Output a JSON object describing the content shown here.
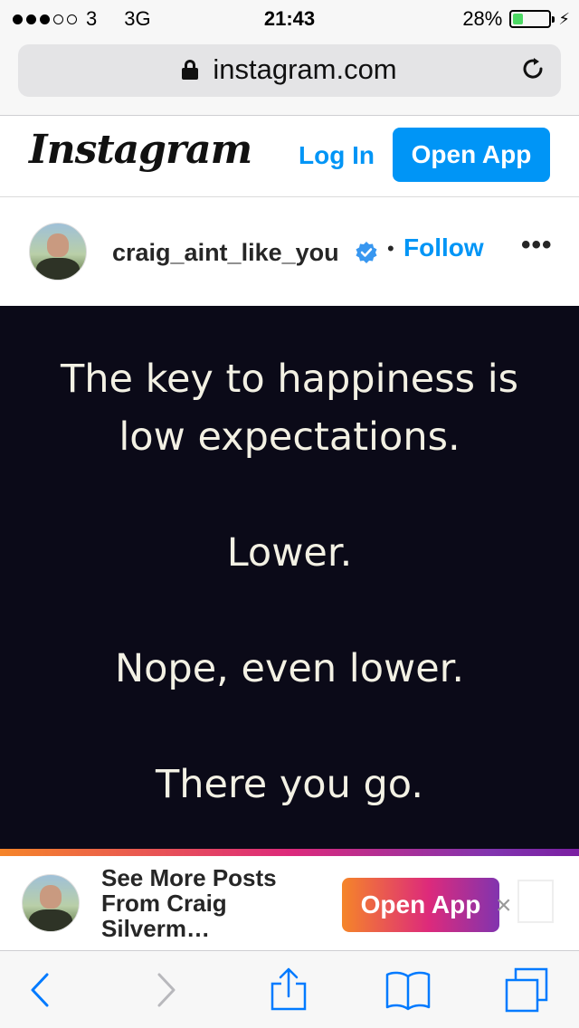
{
  "status_bar": {
    "carrier": "3",
    "network": "3G",
    "time": "21:43",
    "battery_percent": "28%",
    "battery_level": 0.28,
    "signal_bars": 3
  },
  "browser": {
    "url": "instagram.com"
  },
  "ig_header": {
    "logo": "Instagram",
    "login_label": "Log In",
    "open_app_label": "Open App"
  },
  "post": {
    "username": "craig_aint_like_you",
    "separator": "•",
    "follow_label": "Follow",
    "more_label": "•••",
    "image_text": [
      "The key to happiness is",
      "low expectations.",
      "Lower.",
      "Nope, even lower.",
      "There you go."
    ]
  },
  "banner": {
    "text": "See More Posts From Craig Silverm…",
    "open_app_label": "Open App",
    "close_label": "×"
  },
  "colors": {
    "ig_blue": "#0095f6",
    "post_bg": "#0b0a18",
    "post_text": "#f3f1e4",
    "ios_blue": "#007aff",
    "battery_green": "#4cd964"
  },
  "icons": [
    "lock-icon",
    "reload-icon",
    "verified-badge-icon",
    "back-icon",
    "forward-icon",
    "share-icon",
    "bookmarks-icon",
    "tabs-icon"
  ]
}
